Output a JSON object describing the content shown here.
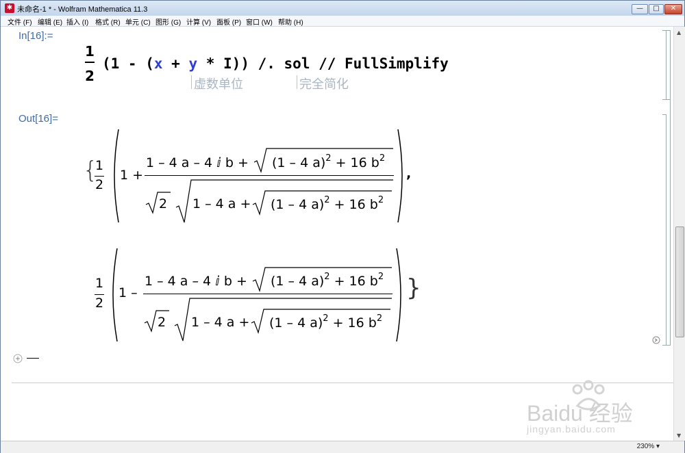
{
  "window": {
    "title": "未命名-1 * - Wolfram Mathematica 11.3",
    "minimize": "—",
    "maximize": "□",
    "close": "✕"
  },
  "menu": [
    "文件 (F)",
    "编辑 (E)",
    "插入 (I)",
    "格式 (R)",
    "单元 (C)",
    "图形 (G)",
    "计算 (V)",
    "面板 (P)",
    "窗口 (W)",
    "帮助 (H)"
  ],
  "input_cell": {
    "label": "In[16]:=",
    "frac_num": "1",
    "frac_den": "2",
    "expr_pre": "(1 - (",
    "x": "x",
    "plus": " + ",
    "y": "y",
    "expr_post": " * I)) /. sol // FullSimplify",
    "hint1": "虚数单位",
    "hint2": "完全简化"
  },
  "output_cell": {
    "label": "Out[16]=",
    "half_num": "1",
    "half_den": "2",
    "open_brace": "{",
    "close_brace": "}",
    "comma": ",",
    "sol1": {
      "lead": "1 +",
      "numerator": "1 – 4 a – 4 ⅈ b +",
      "radicand": "(1 – 4 a)",
      "exp": "2",
      "tail": "+ 16 b",
      "tail_exp": "2",
      "den_sqrt2": "2",
      "den_inner": "1 – 4 a +"
    },
    "sol2": {
      "lead": "1 –",
      "numerator": "1 – 4 a – 4 ⅈ b +",
      "radicand": "(1 – 4 a)",
      "exp": "2",
      "tail": "+ 16 b",
      "tail_exp": "2",
      "den_sqrt2": "2",
      "den_inner": "1 – 4 a +"
    }
  },
  "status": {
    "zoom": "230%"
  },
  "watermark": {
    "brand": "Baidu 经验",
    "url": "jingyan.baidu.com"
  }
}
